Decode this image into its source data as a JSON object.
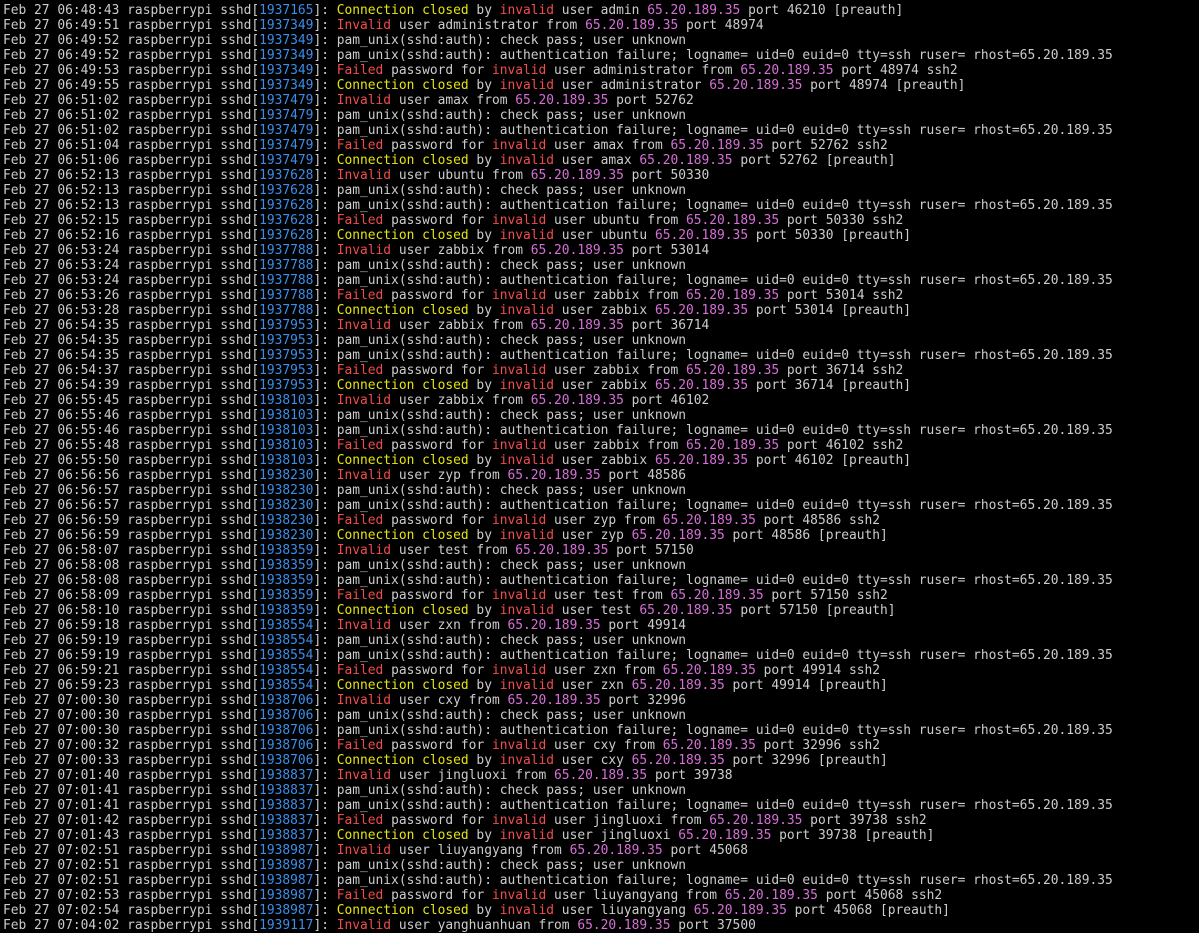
{
  "host": "raspberrypi",
  "prog": "sshd",
  "ip": "65.20.189.35",
  "colors": {
    "background": "#000000",
    "text": "#cccccc",
    "pid": "#3b8eea",
    "failed_invalid": "#f14c4c",
    "connection_closed": "#e5e510",
    "ip": "#d670d6"
  },
  "lines": [
    {
      "ts": "Feb 27 06:48:43",
      "pid": "1937165",
      "type": "closed",
      "user": "admin",
      "port": "46210"
    },
    {
      "ts": "Feb 27 06:49:51",
      "pid": "1937349",
      "type": "invalid",
      "user": "administrator",
      "port": "48974"
    },
    {
      "ts": "Feb 27 06:49:52",
      "pid": "1937349",
      "type": "check"
    },
    {
      "ts": "Feb 27 06:49:52",
      "pid": "1937349",
      "type": "authfail"
    },
    {
      "ts": "Feb 27 06:49:53",
      "pid": "1937349",
      "type": "failed",
      "user": "administrator",
      "port": "48974"
    },
    {
      "ts": "Feb 27 06:49:55",
      "pid": "1937349",
      "type": "closed",
      "user": "administrator",
      "port": "48974"
    },
    {
      "ts": "Feb 27 06:51:02",
      "pid": "1937479",
      "type": "invalid",
      "user": "amax",
      "port": "52762"
    },
    {
      "ts": "Feb 27 06:51:02",
      "pid": "1937479",
      "type": "check"
    },
    {
      "ts": "Feb 27 06:51:02",
      "pid": "1937479",
      "type": "authfail"
    },
    {
      "ts": "Feb 27 06:51:04",
      "pid": "1937479",
      "type": "failed",
      "user": "amax",
      "port": "52762"
    },
    {
      "ts": "Feb 27 06:51:06",
      "pid": "1937479",
      "type": "closed",
      "user": "amax",
      "port": "52762"
    },
    {
      "ts": "Feb 27 06:52:13",
      "pid": "1937628",
      "type": "invalid",
      "user": "ubuntu",
      "port": "50330"
    },
    {
      "ts": "Feb 27 06:52:13",
      "pid": "1937628",
      "type": "check"
    },
    {
      "ts": "Feb 27 06:52:13",
      "pid": "1937628",
      "type": "authfail"
    },
    {
      "ts": "Feb 27 06:52:15",
      "pid": "1937628",
      "type": "failed",
      "user": "ubuntu",
      "port": "50330"
    },
    {
      "ts": "Feb 27 06:52:16",
      "pid": "1937628",
      "type": "closed",
      "user": "ubuntu",
      "port": "50330"
    },
    {
      "ts": "Feb 27 06:53:24",
      "pid": "1937788",
      "type": "invalid",
      "user": "zabbix",
      "port": "53014"
    },
    {
      "ts": "Feb 27 06:53:24",
      "pid": "1937788",
      "type": "check"
    },
    {
      "ts": "Feb 27 06:53:24",
      "pid": "1937788",
      "type": "authfail"
    },
    {
      "ts": "Feb 27 06:53:26",
      "pid": "1937788",
      "type": "failed",
      "user": "zabbix",
      "port": "53014"
    },
    {
      "ts": "Feb 27 06:53:28",
      "pid": "1937788",
      "type": "closed",
      "user": "zabbix",
      "port": "53014"
    },
    {
      "ts": "Feb 27 06:54:35",
      "pid": "1937953",
      "type": "invalid",
      "user": "zabbix",
      "port": "36714"
    },
    {
      "ts": "Feb 27 06:54:35",
      "pid": "1937953",
      "type": "check"
    },
    {
      "ts": "Feb 27 06:54:35",
      "pid": "1937953",
      "type": "authfail"
    },
    {
      "ts": "Feb 27 06:54:37",
      "pid": "1937953",
      "type": "failed",
      "user": "zabbix",
      "port": "36714"
    },
    {
      "ts": "Feb 27 06:54:39",
      "pid": "1937953",
      "type": "closed",
      "user": "zabbix",
      "port": "36714"
    },
    {
      "ts": "Feb 27 06:55:45",
      "pid": "1938103",
      "type": "invalid",
      "user": "zabbix",
      "port": "46102"
    },
    {
      "ts": "Feb 27 06:55:46",
      "pid": "1938103",
      "type": "check"
    },
    {
      "ts": "Feb 27 06:55:46",
      "pid": "1938103",
      "type": "authfail"
    },
    {
      "ts": "Feb 27 06:55:48",
      "pid": "1938103",
      "type": "failed",
      "user": "zabbix",
      "port": "46102"
    },
    {
      "ts": "Feb 27 06:55:50",
      "pid": "1938103",
      "type": "closed",
      "user": "zabbix",
      "port": "46102"
    },
    {
      "ts": "Feb 27 06:56:56",
      "pid": "1938230",
      "type": "invalid",
      "user": "zyp",
      "port": "48586"
    },
    {
      "ts": "Feb 27 06:56:57",
      "pid": "1938230",
      "type": "check"
    },
    {
      "ts": "Feb 27 06:56:57",
      "pid": "1938230",
      "type": "authfail"
    },
    {
      "ts": "Feb 27 06:56:59",
      "pid": "1938230",
      "type": "failed",
      "user": "zyp",
      "port": "48586"
    },
    {
      "ts": "Feb 27 06:56:59",
      "pid": "1938230",
      "type": "closed",
      "user": "zyp",
      "port": "48586"
    },
    {
      "ts": "Feb 27 06:58:07",
      "pid": "1938359",
      "type": "invalid",
      "user": "test",
      "port": "57150"
    },
    {
      "ts": "Feb 27 06:58:08",
      "pid": "1938359",
      "type": "check"
    },
    {
      "ts": "Feb 27 06:58:08",
      "pid": "1938359",
      "type": "authfail"
    },
    {
      "ts": "Feb 27 06:58:09",
      "pid": "1938359",
      "type": "failed",
      "user": "test",
      "port": "57150"
    },
    {
      "ts": "Feb 27 06:58:10",
      "pid": "1938359",
      "type": "closed",
      "user": "test",
      "port": "57150"
    },
    {
      "ts": "Feb 27 06:59:18",
      "pid": "1938554",
      "type": "invalid",
      "user": "zxn",
      "port": "49914"
    },
    {
      "ts": "Feb 27 06:59:19",
      "pid": "1938554",
      "type": "check"
    },
    {
      "ts": "Feb 27 06:59:19",
      "pid": "1938554",
      "type": "authfail"
    },
    {
      "ts": "Feb 27 06:59:21",
      "pid": "1938554",
      "type": "failed",
      "user": "zxn",
      "port": "49914"
    },
    {
      "ts": "Feb 27 06:59:23",
      "pid": "1938554",
      "type": "closed",
      "user": "zxn",
      "port": "49914"
    },
    {
      "ts": "Feb 27 07:00:30",
      "pid": "1938706",
      "type": "invalid",
      "user": "cxy",
      "port": "32996"
    },
    {
      "ts": "Feb 27 07:00:30",
      "pid": "1938706",
      "type": "check"
    },
    {
      "ts": "Feb 27 07:00:30",
      "pid": "1938706",
      "type": "authfail"
    },
    {
      "ts": "Feb 27 07:00:32",
      "pid": "1938706",
      "type": "failed",
      "user": "cxy",
      "port": "32996"
    },
    {
      "ts": "Feb 27 07:00:33",
      "pid": "1938706",
      "type": "closed",
      "user": "cxy",
      "port": "32996"
    },
    {
      "ts": "Feb 27 07:01:40",
      "pid": "1938837",
      "type": "invalid",
      "user": "jingluoxi",
      "port": "39738"
    },
    {
      "ts": "Feb 27 07:01:41",
      "pid": "1938837",
      "type": "check"
    },
    {
      "ts": "Feb 27 07:01:41",
      "pid": "1938837",
      "type": "authfail"
    },
    {
      "ts": "Feb 27 07:01:42",
      "pid": "1938837",
      "type": "failed",
      "user": "jingluoxi",
      "port": "39738"
    },
    {
      "ts": "Feb 27 07:01:43",
      "pid": "1938837",
      "type": "closed",
      "user": "jingluoxi",
      "port": "39738"
    },
    {
      "ts": "Feb 27 07:02:51",
      "pid": "1938987",
      "type": "invalid",
      "user": "liuyangyang",
      "port": "45068"
    },
    {
      "ts": "Feb 27 07:02:51",
      "pid": "1938987",
      "type": "check"
    },
    {
      "ts": "Feb 27 07:02:51",
      "pid": "1938987",
      "type": "authfail"
    },
    {
      "ts": "Feb 27 07:02:53",
      "pid": "1938987",
      "type": "failed",
      "user": "liuyangyang",
      "port": "45068"
    },
    {
      "ts": "Feb 27 07:02:54",
      "pid": "1938987",
      "type": "closed",
      "user": "liuyangyang",
      "port": "45068"
    },
    {
      "ts": "Feb 27 07:04:02",
      "pid": "1939117",
      "type": "invalid",
      "user": "yanghuanhuan",
      "port": "37500"
    }
  ]
}
